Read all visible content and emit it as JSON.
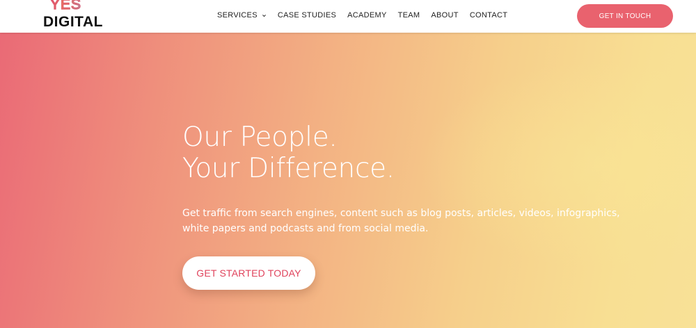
{
  "brand": {
    "logo_top": "YES",
    "logo_bottom": "DIGITAL"
  },
  "nav": {
    "items": [
      {
        "label": "SERVICES",
        "has_dropdown": true
      },
      {
        "label": "CASE STUDIES"
      },
      {
        "label": "ACADEMY"
      },
      {
        "label": "TEAM"
      },
      {
        "label": "ABOUT"
      },
      {
        "label": "CONTACT"
      }
    ],
    "cta_label": "GET IN TOUCH"
  },
  "hero": {
    "title_line1": "Our People.",
    "title_line2": "Your Difference.",
    "subtitle": "Get traffic from search engines, content such as blog posts, articles, videos, infographics, white papers and podcasts and from social media.",
    "cta_label": "GET STARTED TODAY"
  },
  "colors": {
    "accent": "#e9626e",
    "cta_text": "#e0435c",
    "gradient_start": "#ea6a76",
    "gradient_end": "#f8e197"
  },
  "icons": {
    "dropdown": "chevron-down-icon"
  }
}
